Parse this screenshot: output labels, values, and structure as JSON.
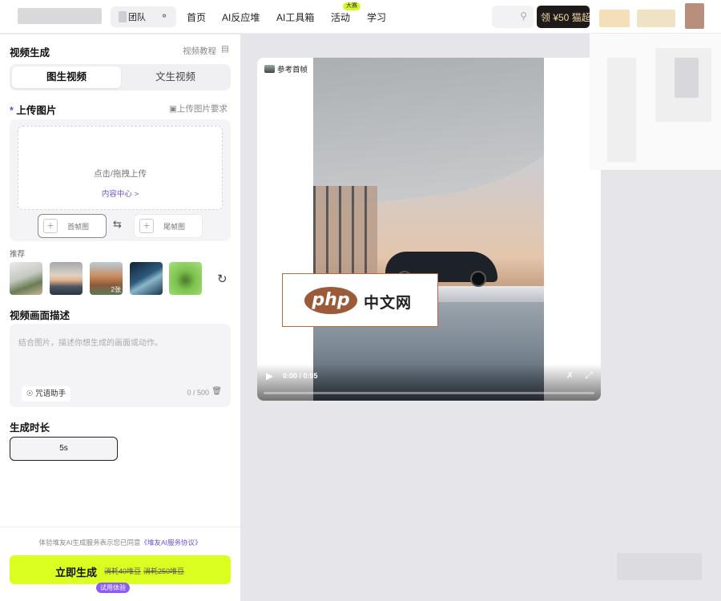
{
  "topbar": {
    "team_label": "团队",
    "nav": [
      {
        "label": "首页"
      },
      {
        "label": "AI反应堆"
      },
      {
        "label": "AI工具箱"
      },
      {
        "label": "活动"
      },
      {
        "label": "学习"
      }
    ],
    "activity_badge": "大赛",
    "coupon_label": "领 ¥50 猫超"
  },
  "panel": {
    "title": "视频生成",
    "tutorial_link": "视频教程",
    "tabs": [
      {
        "label": "图生视频",
        "active": true
      },
      {
        "label": "文生视频",
        "active": false
      }
    ],
    "upload": {
      "title": "上传图片",
      "requirements_link": "上传图片要求",
      "hint": "点击/拖拽上传",
      "content_center": "内容中心 >",
      "first_frame": "首帧图",
      "last_frame": "尾帧图"
    },
    "recommend": {
      "label": "推荐",
      "count_badge": "2张"
    },
    "description": {
      "title": "视频画面描述",
      "placeholder": "结合图片，描述你想生成的画面或动作。",
      "assistant": "咒语助手",
      "counter": "0 / 500"
    },
    "duration": {
      "title": "生成时长",
      "value": "5s"
    },
    "footer": {
      "agreement_prefix": "体验堆友AI生成服务表示您已同意",
      "agreement_link": "《堆友AI服务协议》",
      "generate": "立即生成",
      "cost1": "消耗40堆豆",
      "cost2": "消耗250堆豆",
      "trial_badge": "试用体验"
    }
  },
  "preview": {
    "ref_tag": "参考首帧",
    "time": "0:00 / 0:05",
    "progress": 0.0
  },
  "watermark": {
    "logo": "php",
    "text": "中文网"
  },
  "colors": {
    "accent_green": "#dbff21",
    "link_purple": "#6b4fd6",
    "badge_purple": "#8b5cf6",
    "coupon_bg": "#1e1a1a"
  }
}
